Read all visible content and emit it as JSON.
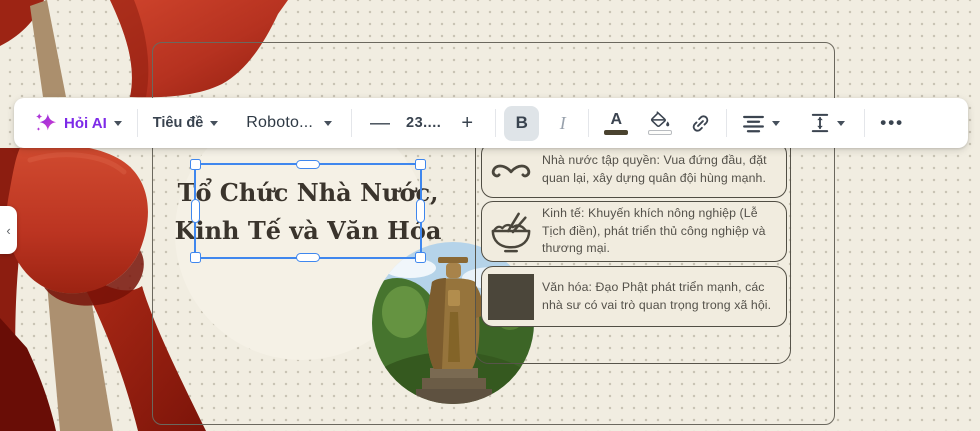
{
  "toolbar": {
    "ai_label": "Hỏi AI",
    "style_label": "Tiêu đề",
    "font_label": "Roboto...",
    "minus_label": "—",
    "font_size": "23....",
    "plus_label": "+",
    "bold_label": "B",
    "italic_label": "I",
    "text_color_label": "A",
    "more_label": "•••",
    "colors": {
      "ai_purple": "#7d2ae8",
      "icon_ink": "#3b4450",
      "bold_active_bg": "#dfe4e8",
      "text_color_swatch": "#4a432f",
      "fill_color_swatch": "#fdfdfb"
    }
  },
  "side_panel": {
    "collapse_label": "‹"
  },
  "canvas": {
    "title": {
      "line1": "Tổ Chức Nhà Nước,",
      "line2": "Kinh Tế và Văn Hóa",
      "selected": true,
      "selection_color": "#3f87ee"
    },
    "list_items": [
      {
        "icon": "mustache-icon",
        "text": "Nhà nước tập quyền: Vua đứng đầu, đặt quan lại, xây dựng quân đội hùng mạnh."
      },
      {
        "icon": "rice-bowl-icon",
        "text": "Kinh tế: Khuyến khích nông nghiệp (Lễ Tịch điền), phát triển thủ công nghiệp và thương mại."
      },
      {
        "icon": "dark-square-icon",
        "text": "Văn hóa: Đạo Phật phát triển mạnh, các nhà sư có vai trò quan trọng trong xã hội."
      }
    ],
    "image_description": "bronze statue among trees",
    "decoration": "red silk ribbon"
  }
}
